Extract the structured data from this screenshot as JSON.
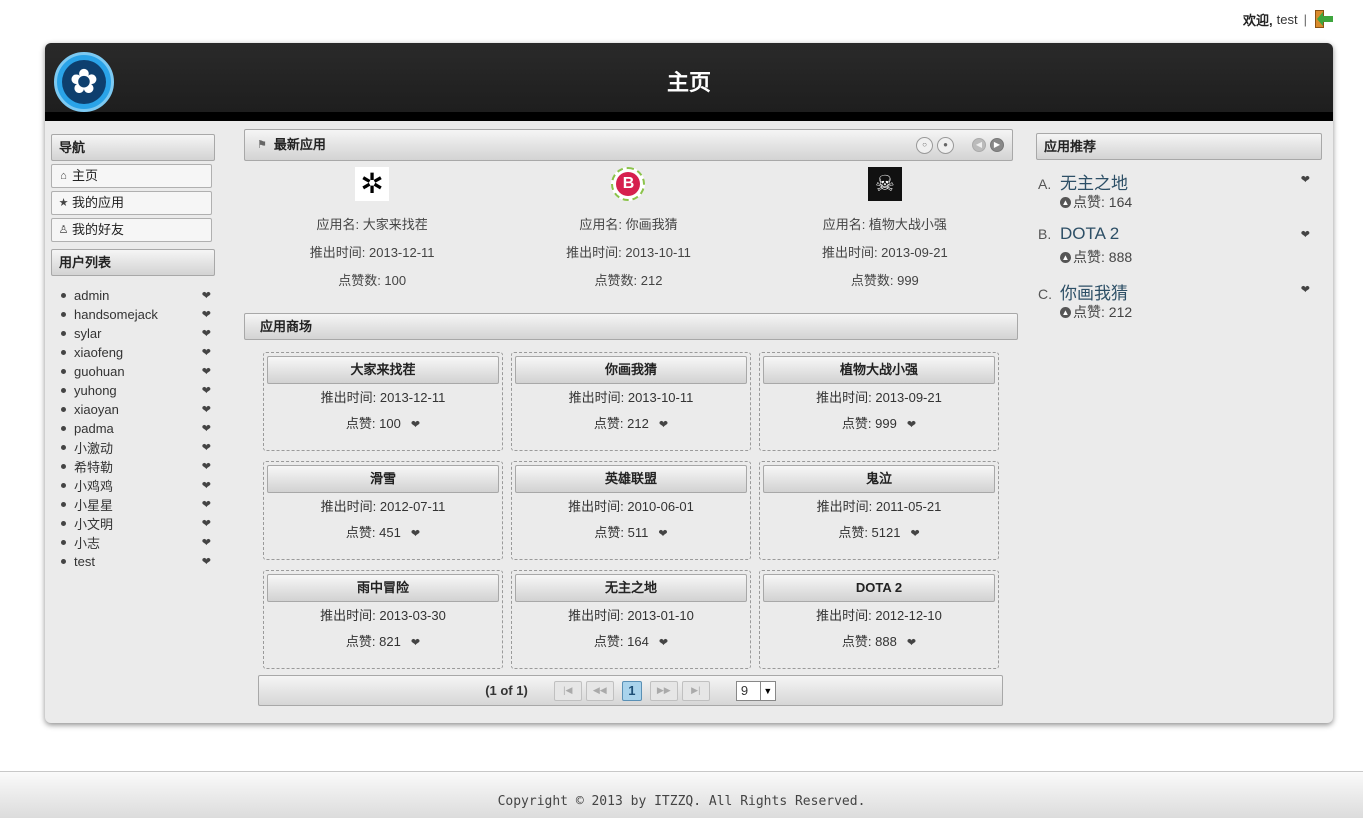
{
  "topbar": {
    "welcome": "欢迎,",
    "user": "test",
    "sep": "|"
  },
  "header": {
    "title": "主页"
  },
  "nav": {
    "title": "导航",
    "items": [
      {
        "label": "主页",
        "icon": "⌂"
      },
      {
        "label": "我的应用",
        "icon": "★"
      },
      {
        "label": "我的好友",
        "icon": "♙"
      }
    ]
  },
  "userlist": {
    "title": "用户列表",
    "users": [
      "admin",
      "handsomejack",
      "sylar",
      "xiaofeng",
      "guohuan",
      "yuhong",
      "xiaoyan",
      "padma",
      "小激动",
      "希特勒",
      "小鸡鸡",
      "小星星",
      "小文明",
      "小志",
      "test"
    ]
  },
  "new_apps": {
    "title": "最新应用",
    "items": [
      {
        "name": "应用名: 大家来找茬",
        "date": "推出时间: 2013-12-11",
        "likes": "点赞数: 100",
        "icon": "gear-icon"
      },
      {
        "name": "应用名: 你画我猜",
        "date": "推出时间: 2013-10-11",
        "likes": "点赞数: 212",
        "icon": "b-badge-icon"
      },
      {
        "name": "应用名: 植物大战小强",
        "date": "推出时间: 2013-09-21",
        "likes": "点赞数: 999",
        "icon": "skull-icon"
      }
    ]
  },
  "store": {
    "title": "应用商场",
    "cards": [
      {
        "name": "大家来找茬",
        "date": "推出时间: 2013-12-11",
        "likes": "点赞: 100"
      },
      {
        "name": "你画我猜",
        "date": "推出时间: 2013-10-11",
        "likes": "点赞: 212"
      },
      {
        "name": "植物大战小强",
        "date": "推出时间: 2013-09-21",
        "likes": "点赞: 999"
      },
      {
        "name": "滑雪",
        "date": "推出时间: 2012-07-11",
        "likes": "点赞: 451"
      },
      {
        "name": "英雄联盟",
        "date": "推出时间: 2010-06-01",
        "likes": "点赞: 511"
      },
      {
        "name": "鬼泣",
        "date": "推出时间: 2011-05-21",
        "likes": "点赞: 5121"
      },
      {
        "name": "雨中冒险",
        "date": "推出时间: 2013-03-30",
        "likes": "点赞: 821"
      },
      {
        "name": "无主之地",
        "date": "推出时间: 2013-01-10",
        "likes": "点赞: 164"
      },
      {
        "name": "DOTA 2",
        "date": "推出时间: 2012-12-10",
        "likes": "点赞: 888"
      }
    ],
    "pager": {
      "report": "(1 of 1)",
      "page": "1",
      "rows": "9"
    }
  },
  "recommend": {
    "title": "应用推荐",
    "items": [
      {
        "letter": "A.",
        "name": "无主之地",
        "likes": "点赞: 164"
      },
      {
        "letter": "B.",
        "name": "DOTA 2",
        "likes": "点赞: 888"
      },
      {
        "letter": "C.",
        "name": "你画我猜",
        "likes": "点赞: 212"
      }
    ]
  },
  "footer": {
    "text": "Copyright © 2013 by ITZZQ. All Rights Reserved."
  }
}
